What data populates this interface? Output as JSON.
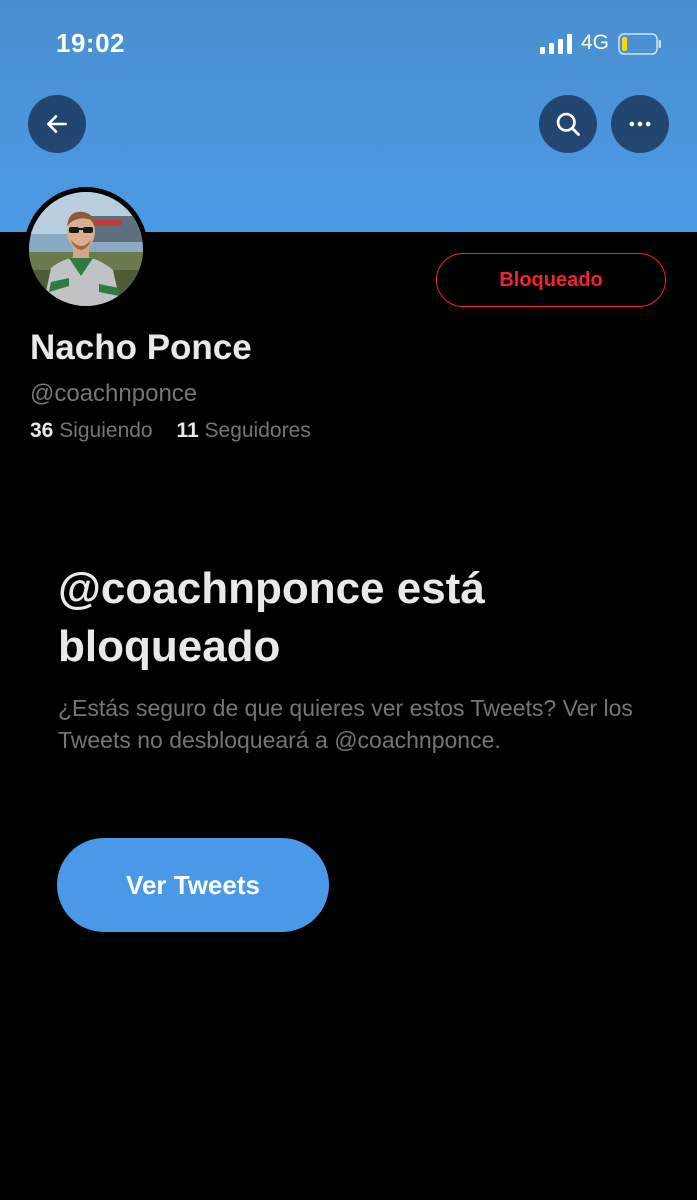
{
  "status_bar": {
    "time": "19:02",
    "network": "4G",
    "icons": [
      "signal-icon",
      "battery-icon"
    ]
  },
  "header": {
    "icons": [
      "back-arrow-icon",
      "search-icon",
      "more-icon"
    ],
    "banner_color": "#4b9ae6"
  },
  "profile": {
    "avatar": "avatar",
    "blocked_label": "Bloqueado",
    "display_name": "Nacho Ponce",
    "handle": "@coachnponce",
    "following_count": "36",
    "following_label": "Siguiendo",
    "followers_count": "11",
    "followers_label": "Seguidores"
  },
  "blocked_notice": {
    "title": "@coachnponce está bloqueado",
    "description": "¿Estás seguro de que quieres ver estos Tweets? Ver los Tweets no desbloqueará a @coachnponce.",
    "button_label": "Ver Tweets"
  },
  "colors": {
    "accent": "#4a99e9",
    "danger": "#f4212e",
    "background": "#000000",
    "muted_text": "#71767b"
  }
}
